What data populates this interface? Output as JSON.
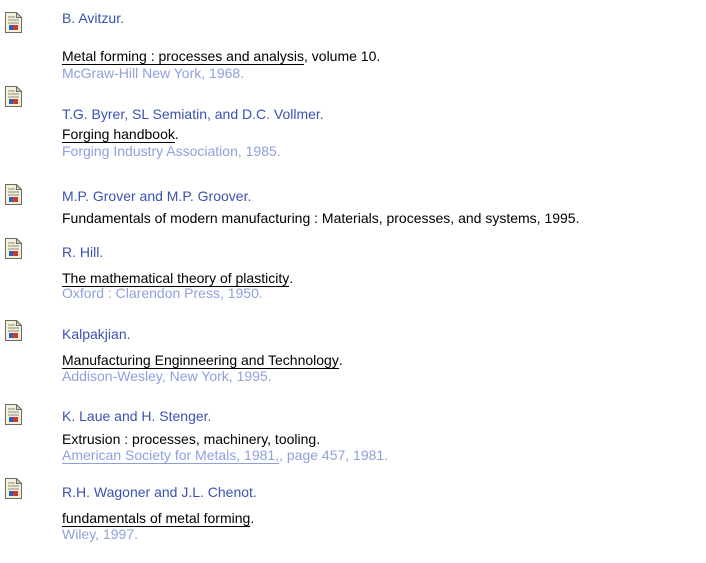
{
  "references": [
    {
      "author": "B. Avitzur.",
      "title": "Metal forming : processes and analysis",
      "title_suffix": ", volume 10.",
      "publisher": "McGraw-Hill New York, 1968.",
      "icon": "document-icon"
    },
    {
      "author": "T.G. Byrer, SL Semiatin, and D.C. Vollmer.",
      "title": "Forging handbook",
      "title_suffix": ".",
      "publisher": "Forging Industry Association, 1985.",
      "icon": "document-icon"
    },
    {
      "author": "M.P. Grover and M.P. Groover.",
      "title_plain": "Fundamentals of modern manufacturing : Materials, processes, and systems, 1995.",
      "icon": "document-icon"
    },
    {
      "author": "R. Hill.",
      "title": "The mathematical theory of plasticity",
      "title_suffix": ".",
      "publisher": "Oxford : Clarendon Press, 1950.",
      "icon": "document-icon"
    },
    {
      "author": "Kalpakjian.",
      "title": "Manufacturing Enginneering and Technology",
      "title_suffix": ".",
      "publisher": "Addison-Wesley, New York, 1995.",
      "icon": "document-icon"
    },
    {
      "author": "K. Laue and H. Stenger.",
      "title_plain": "Extrusion : processes, machinery, tooling.",
      "publisher_link": "American Society for Metals, 1981,",
      "publisher_suffix": ", page 457, 1981.",
      "icon": "document-icon"
    },
    {
      "author": "R.H. Wagoner and J.L. Chenot.",
      "title": "fundamentals of metal forming",
      "title_suffix": ".",
      "publisher": "Wiley, 1997.",
      "icon": "document-icon"
    }
  ],
  "colors": {
    "author": "#3a52b0",
    "publisher": "#8fa0dc",
    "title": "#000000"
  }
}
